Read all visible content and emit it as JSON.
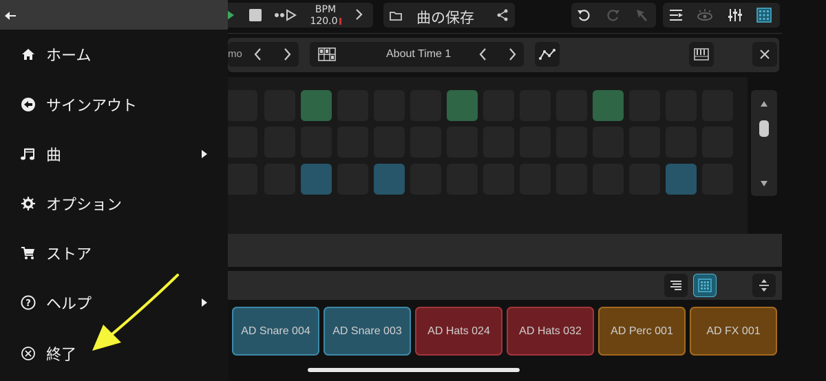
{
  "toolbar": {
    "bpm_label": "BPM",
    "bpm_value": "120.0",
    "song_title": "曲の保存"
  },
  "pattern_bar": {
    "partial_text": "mo",
    "scene_name": "About Time 1"
  },
  "pads": [
    {
      "label": "AD Snare 004",
      "color": "#285669"
    },
    {
      "label": "AD Snare 003",
      "color": "#285669"
    },
    {
      "label": "AD Hats 024",
      "color": "#6f1f23"
    },
    {
      "label": "AD Hats 032",
      "color": "#6f1f23"
    },
    {
      "label": "AD Perc 001",
      "color": "#6b4412"
    },
    {
      "label": "AD FX 001",
      "color": "#6b4412"
    }
  ],
  "menu": {
    "items": [
      {
        "label": "ホーム",
        "icon": "home-icon"
      },
      {
        "label": "サインアウト",
        "icon": "sign-out-icon"
      },
      {
        "label": "曲",
        "icon": "music-note-icon"
      },
      {
        "label": "オプション",
        "icon": "gear-icon"
      },
      {
        "label": "ストア",
        "icon": "cart-icon"
      },
      {
        "label": "ヘルプ",
        "icon": "help-icon"
      },
      {
        "label": "終了",
        "icon": "close-circle-icon"
      }
    ]
  },
  "colors": {
    "green_step": "#2e6646",
    "blue_step": "#27556a",
    "accent_arrow": "#f5f53a"
  }
}
